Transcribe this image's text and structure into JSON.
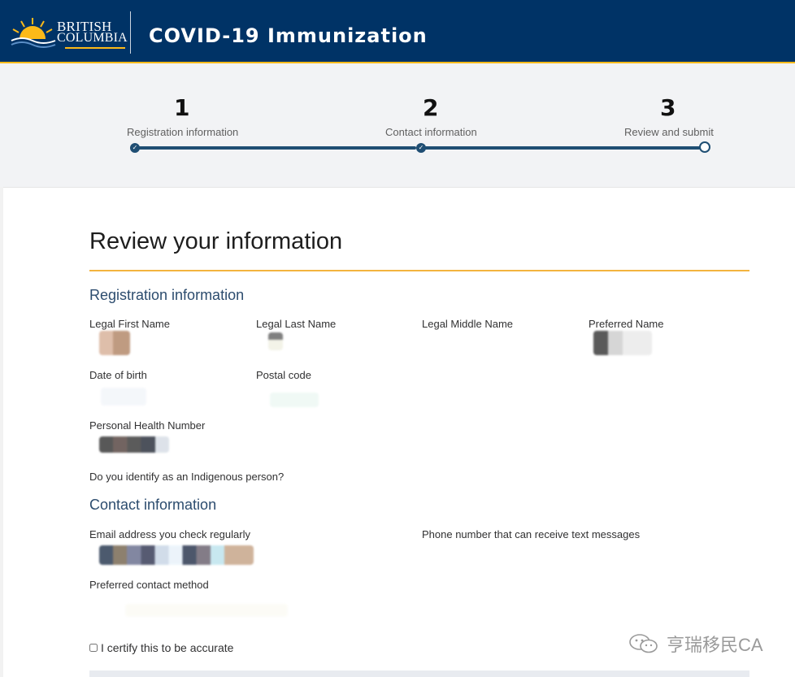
{
  "header": {
    "logo_line1": "BRITISH",
    "logo_line2": "COLUMBIA",
    "title": "COVID-19 Immunization",
    "colors": {
      "navy": "#003366",
      "gold": "#fcba19"
    }
  },
  "stepper": {
    "steps": [
      {
        "number": "1",
        "label": "Registration information",
        "state": "complete"
      },
      {
        "number": "2",
        "label": "Contact information",
        "state": "complete"
      },
      {
        "number": "3",
        "label": "Review and submit",
        "state": "current"
      }
    ],
    "check_glyph": "✓"
  },
  "review": {
    "title": "Review your information",
    "registration": {
      "heading": "Registration information",
      "first_name_label": "Legal First Name",
      "last_name_label": "Legal Last Name",
      "middle_name_label": "Legal Middle Name",
      "preferred_name_label": "Preferred Name",
      "dob_label": "Date of birth",
      "postal_label": "Postal code",
      "phn_label": "Personal Health Number",
      "indigenous_label": "Do you identify as an Indigenous person?"
    },
    "contact": {
      "heading": "Contact information",
      "email_label": "Email address you check regularly",
      "phone_label": "Phone number that can receive text messages",
      "method_label": "Preferred contact method"
    },
    "certify_label": "I certify this to be accurate",
    "certify_checked": false
  },
  "watermark": {
    "text": "亨瑞移民CA",
    "icon": "wechat-icon"
  }
}
